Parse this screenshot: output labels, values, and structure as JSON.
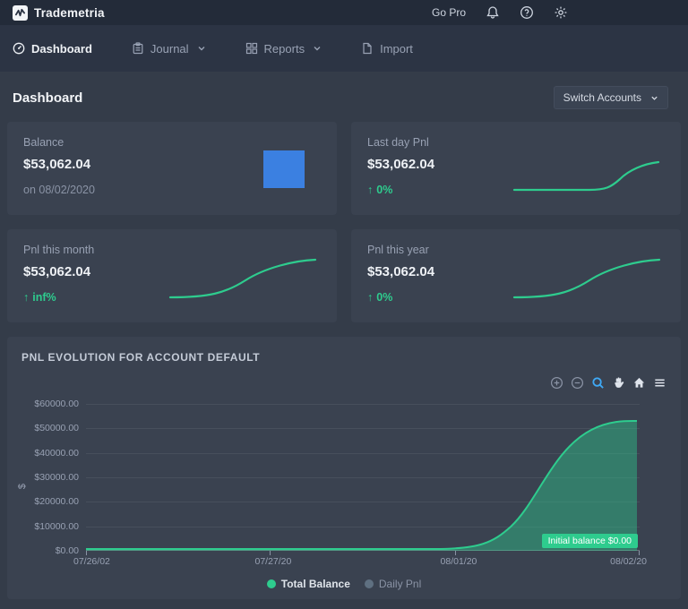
{
  "header": {
    "brand": "Trademetria",
    "go_pro_label": "Go Pro",
    "icons": [
      "bell-icon",
      "help-icon",
      "gear-icon"
    ]
  },
  "nav": {
    "items": [
      {
        "label": "Dashboard",
        "icon": "gauge-icon",
        "active": true
      },
      {
        "label": "Journal",
        "icon": "journal-icon",
        "has_dropdown": true
      },
      {
        "label": "Reports",
        "icon": "reports-grid-icon",
        "has_dropdown": true
      },
      {
        "label": "Import",
        "icon": "import-file-icon"
      }
    ]
  },
  "page": {
    "title": "Dashboard",
    "switch_accounts_label": "Switch Accounts"
  },
  "icons_map": {
    "up_arrow": "↑",
    "chevron": "⌄",
    "menu": "≡"
  },
  "cards": [
    {
      "label": "Balance",
      "value": "$53,062.04",
      "sub": "on 08/02/2020"
    },
    {
      "label": "Last day Pnl",
      "value": "$53,062.04",
      "change": "0%"
    },
    {
      "label": "Pnl this month",
      "value": "$53,062.04",
      "change": "inf%"
    },
    {
      "label": "Pnl this year",
      "value": "$53,062.04",
      "change": "0%"
    }
  ],
  "chart_section": {
    "title": "PNL EVOLUTION  FOR ACCOUNT DEFAULT",
    "toolbar_icons": [
      "zoom-in",
      "zoom-out",
      "box-zoom",
      "pan",
      "home-reset",
      "menu"
    ]
  },
  "chart_data": {
    "type": "area",
    "title": "PNL EVOLUTION FOR ACCOUNT DEFAULT",
    "ylabel": "$",
    "ylim": [
      0,
      60000
    ],
    "grid": true,
    "y_ticks": [
      "$60000.00",
      "$50000.00",
      "$40000.00",
      "$30000.00",
      "$20000.00",
      "$10000.00",
      "$0.00"
    ],
    "x_ticks": [
      "07/26/02",
      "07/27/20",
      "08/01/20",
      "08/02/20"
    ],
    "series": [
      {
        "name": "Total Balance",
        "color": "#2ecc8e",
        "visible": true,
        "points": [
          {
            "x": "07/26/02",
            "y": 0
          },
          {
            "x": "07/27/20",
            "y": 0
          },
          {
            "x": "08/01/20",
            "y": 0
          },
          {
            "x": "08/02/20",
            "y": 53062.04
          }
        ]
      },
      {
        "name": "Daily Pnl",
        "color": "#5f7081",
        "visible": false,
        "points": []
      }
    ],
    "annotation": "Initial balance $0.00",
    "legend_position": "bottom"
  },
  "colors": {
    "accent_green": "#2ecc8e",
    "accent_blue": "#3b80e1",
    "active_tool_blue": "#3fa9f5",
    "card_bg": "#3a4250",
    "page_bg": "#343c49",
    "topbar_bg": "#232b39"
  }
}
